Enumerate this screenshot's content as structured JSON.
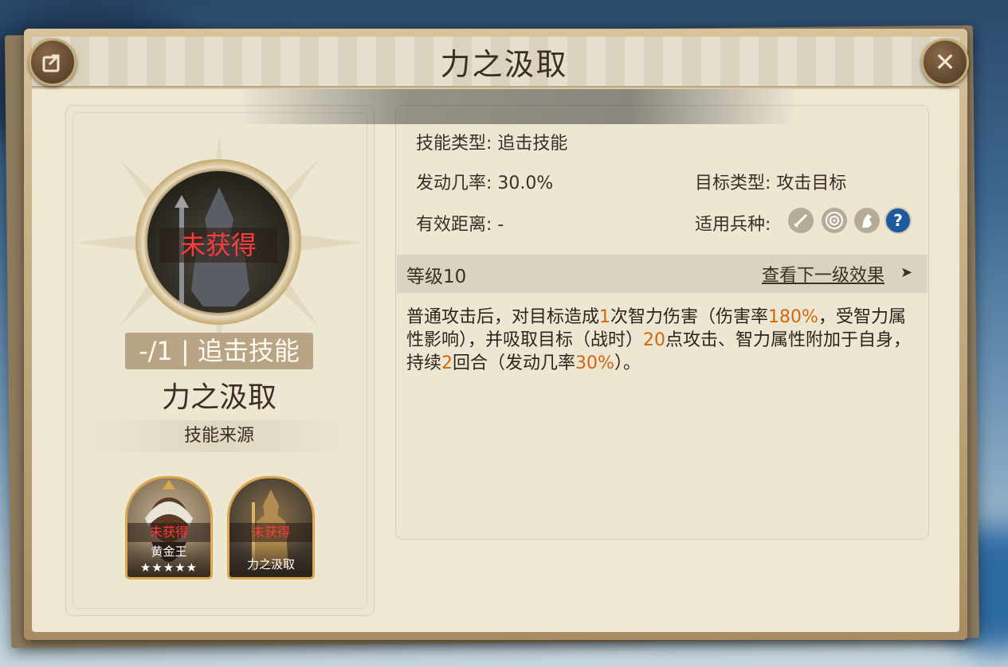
{
  "header": {
    "title": "力之汲取"
  },
  "skill": {
    "status": "未获得",
    "badge": "-/1 | 追击技能",
    "name": "力之汲取",
    "source_label": "技能来源"
  },
  "heroes": [
    {
      "status": "未获得",
      "name": "黄金王",
      "stars": "★★★★★"
    },
    {
      "status": "未获得",
      "name": "力之汲取"
    }
  ],
  "stats": {
    "skill_type": "技能类型: 追击技能",
    "trigger_rate": "发动几率: 30.0%",
    "target_type": "目标类型: 攻击目标",
    "range": "有效距离: -",
    "troop_types_label": "适用兵种:"
  },
  "troop_icons": [
    "sword-icon",
    "target-icon",
    "horse-icon",
    "question-icon"
  ],
  "level": {
    "label": "等级10",
    "next_link": "查看下一级效果"
  },
  "description": {
    "p1": "普通攻击后，对目标造成",
    "n1": "1",
    "p2": "次智力伤害（伤害率",
    "n2": "180%",
    "p3": "，受智力属性影响），并吸取目标（战时）",
    "n3": "20",
    "p4": "点攻击、智力属性附加于自身，持续",
    "n4": "2",
    "p5": "回合（发动几率",
    "n5": "30%",
    "p6": "）。"
  },
  "colors": {
    "highlight": "#d4660c",
    "not_acquired": "#ff3b3b",
    "panel": "#ede7d4"
  }
}
